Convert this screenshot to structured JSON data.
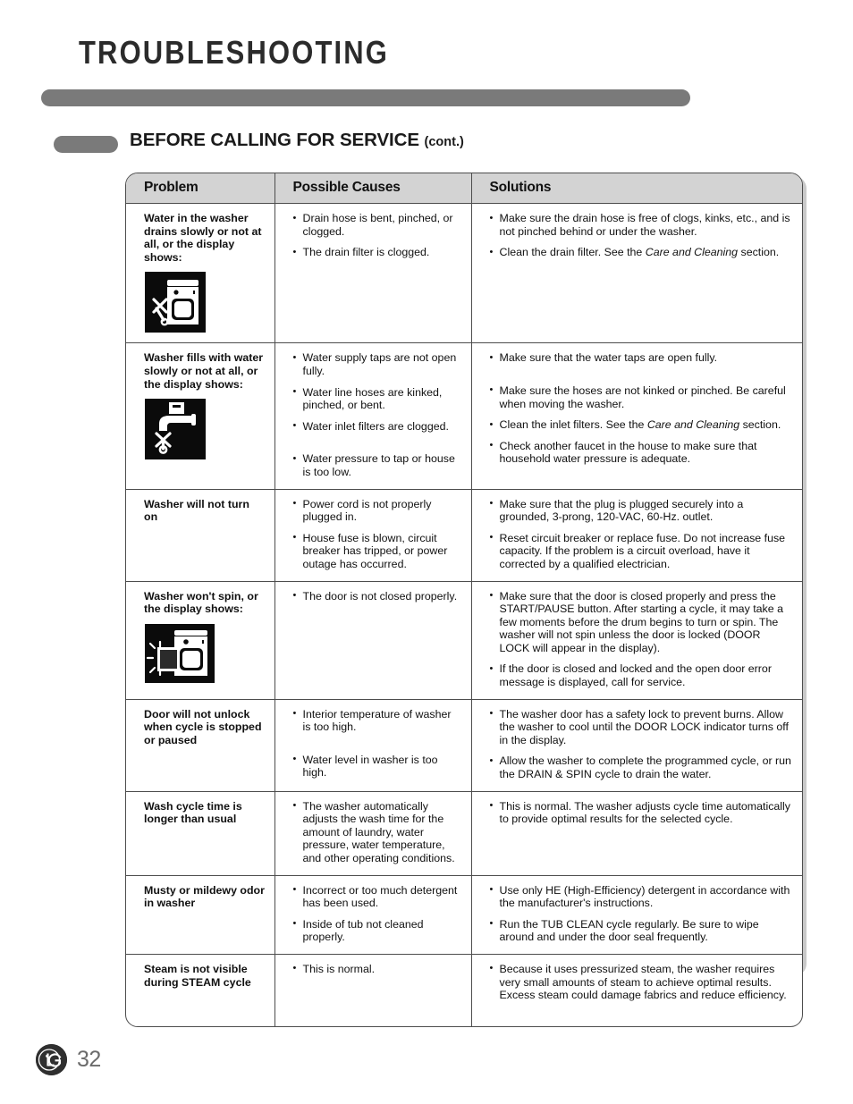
{
  "page": {
    "title": "TROUBLESHOOTING",
    "section_title": "BEFORE CALLING FOR SERVICE",
    "section_title_suffix": "(cont.)",
    "page_number": "32",
    "logo_text": "LG",
    "colors": {
      "bar_gray": "#7a7a7a",
      "header_row_gray": "#d3d3d3",
      "border": "#4d4d4d",
      "icon_background": "#0b0b0b",
      "page_number_gray": "#6b6b6b"
    }
  },
  "table": {
    "headers": [
      "Problem",
      "Possible Causes",
      "Solutions"
    ],
    "rows": [
      {
        "problem": "Water in the washer drains slowly or not at all, or the display shows:",
        "icon": "washer-drain-error-icon",
        "causes": [
          "Drain hose is bent, pinched, or clogged.",
          "The drain filter is clogged."
        ],
        "solutions": [
          {
            "text": "Make sure the drain hose is free of clogs, kinks, etc., and is not pinched behind or under the washer."
          },
          {
            "text_before": "Clean the drain filter. See the ",
            "italic": "Care and Cleaning",
            "text_after": " section."
          }
        ]
      },
      {
        "problem": "Washer fills with water slowly or not at all, or the display shows:",
        "icon": "water-faucet-error-icon",
        "causes": [
          "Water supply taps are not open fully.",
          "Water line hoses are kinked, pinched, or bent.",
          "Water inlet filters are clogged.",
          "Water pressure to tap or house is too low."
        ],
        "solutions": [
          {
            "text": "Make sure that the water taps are open fully."
          },
          {
            "text": "Make sure the hoses are not kinked or pinched. Be careful when moving the washer."
          },
          {
            "text_before": "Clean the inlet filters. See the ",
            "italic": "Care and Cleaning",
            "text_after": " section."
          },
          {
            "text": "Check another faucet in the house to make sure that household water pressure is adequate."
          }
        ]
      },
      {
        "problem": "Washer will not turn on",
        "icon": null,
        "causes": [
          "Power cord is not properly plugged in.",
          "House fuse is blown, circuit breaker has tripped, or power outage has occurred."
        ],
        "solutions": [
          {
            "text": "Make sure that the plug is plugged securely into a grounded, 3-prong, 120-VAC, 60-Hz. outlet."
          },
          {
            "text": "Reset circuit breaker or replace fuse. Do not increase fuse capacity. If the problem is a circuit overload, have it corrected by a qualified electrician."
          }
        ]
      },
      {
        "problem": "Washer won't spin, or the display shows:",
        "icon": "washer-door-open-error-icon",
        "causes": [
          "The door is not closed properly."
        ],
        "solutions": [
          {
            "text": "Make sure that the door is closed properly and press the START/PAUSE button. After starting a cycle, it may take a few moments before the drum begins to turn or spin. The washer will not spin unless the door is locked (DOOR LOCK will appear in the display)."
          },
          {
            "text": "If the door is closed and locked and the open door error message is displayed, call for service."
          }
        ]
      },
      {
        "problem": "Door will not unlock when cycle is stopped or paused",
        "icon": null,
        "causes": [
          "Interior temperature of washer is too high.",
          "Water level in washer is too high."
        ],
        "solutions": [
          {
            "text": "The washer door has a safety lock to prevent burns. Allow the washer to cool until the DOOR LOCK indicator turns off in the display."
          },
          {
            "text": "Allow the washer to complete the programmed cycle, or run the DRAIN & SPIN cycle to drain the water."
          }
        ]
      },
      {
        "problem": "Wash cycle time is longer than usual",
        "icon": null,
        "causes": [
          "The washer automatically adjusts the wash time for the amount of laundry, water pressure, water temperature, and other operating conditions."
        ],
        "solutions": [
          {
            "text": "This is normal. The washer adjusts cycle time automatically to provide optimal results for the selected cycle."
          }
        ]
      },
      {
        "problem": "Musty or mildewy odor in washer",
        "icon": null,
        "causes": [
          "Incorrect or too much detergent has been used.",
          "Inside of tub not cleaned properly."
        ],
        "solutions": [
          {
            "text": "Use only HE (High-Efficiency) detergent in accordance with the manufacturer's instructions."
          },
          {
            "text": "Run the TUB CLEAN cycle regularly. Be sure to wipe around and under the door seal frequently."
          }
        ]
      },
      {
        "problem": "Steam is not visible during STEAM cycle",
        "icon": null,
        "causes": [
          "This is normal."
        ],
        "solutions": [
          {
            "text": "Because it uses pressurized steam, the washer requires very small amounts of steam to achieve optimal results. Excess steam could damage fabrics and reduce efficiency."
          }
        ]
      }
    ]
  }
}
